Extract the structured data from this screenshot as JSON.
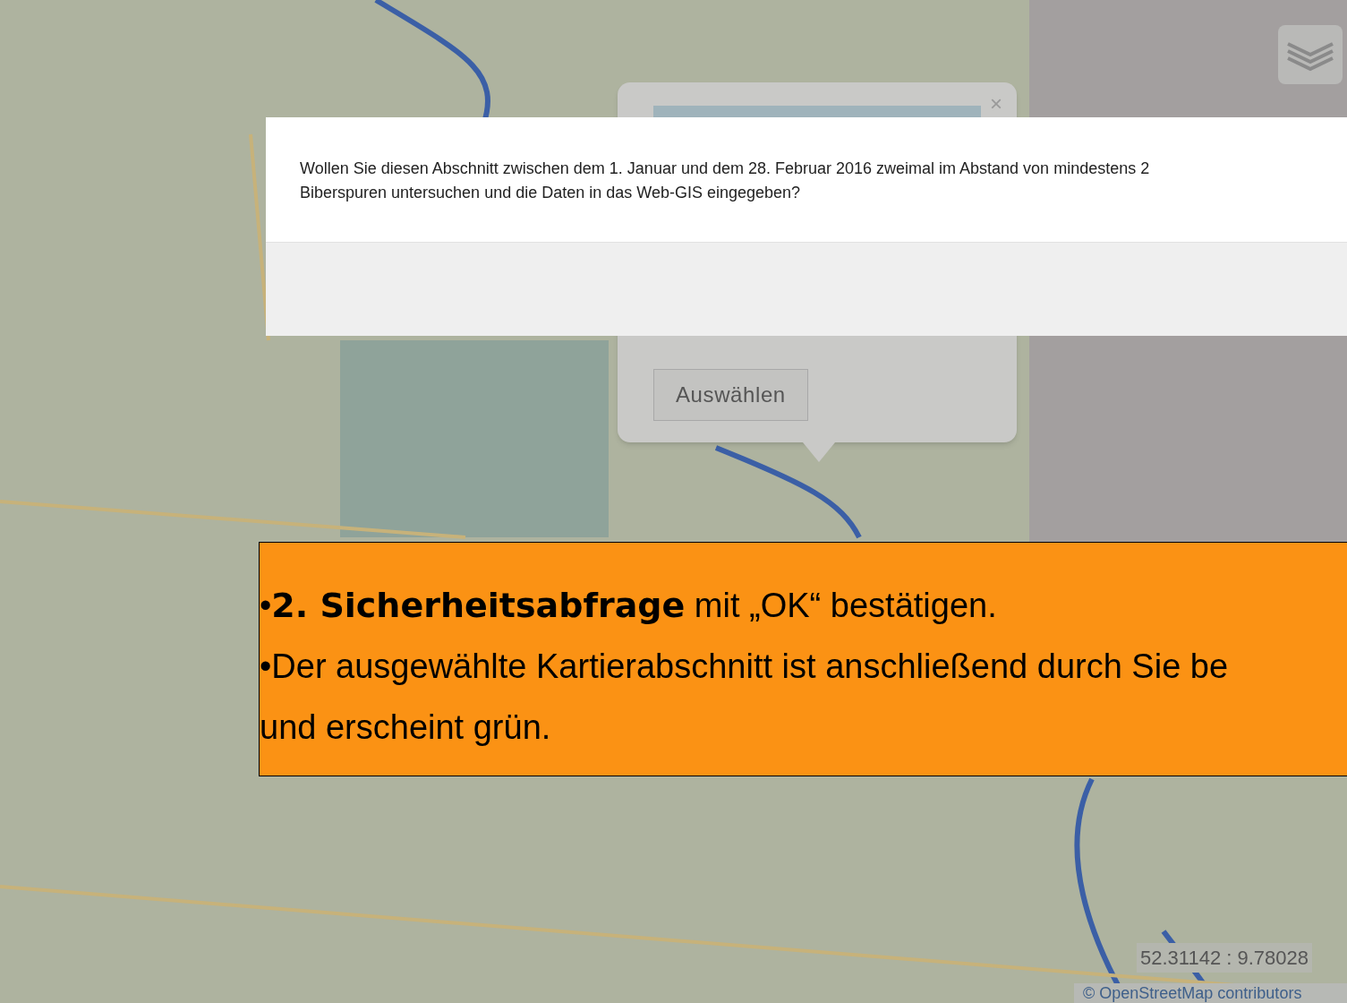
{
  "map": {
    "coordinates": "52.31142 : 9.78028",
    "attribution": "© OpenStreetMap contributors"
  },
  "popup": {
    "close": "×",
    "button": "Auswählen"
  },
  "dialog": {
    "lines": [
      "Wollen Sie diesen Abschnitt zwischen dem 1. Januar und dem 28. Februar 2016 zweimal im Abstand von mindestens 2",
      "Biberspuren untersuchen und die Daten in das Web-GIS eingegeben?"
    ]
  },
  "annotation": {
    "lines": [
      "•**2. Sicherheitsabfrage** mit „OK“ bestätigen.",
      "•Der ausgewählte Kartierabschnitt ist anschließend durch Sie be",
      "und erscheint grün."
    ]
  }
}
